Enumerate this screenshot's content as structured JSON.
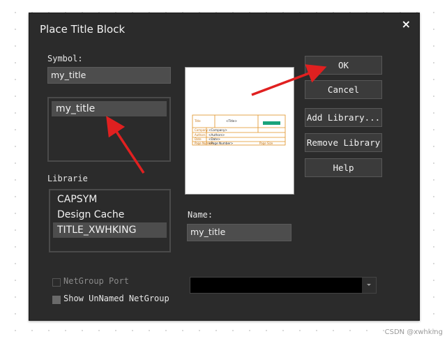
{
  "dialog": {
    "title": "Place Title Block",
    "close_glyph": "×"
  },
  "symbol": {
    "label": "Symbol:",
    "value": "my_title",
    "list": [
      {
        "label": "my_title",
        "selected": true
      }
    ]
  },
  "libraries": {
    "label": "Librarie",
    "items": [
      {
        "label": "CAPSYM",
        "selected": false
      },
      {
        "label": "Design Cache",
        "selected": false
      },
      {
        "label": "TITLE_XWHKING",
        "selected": true
      }
    ]
  },
  "preview": {
    "title_label": "Title",
    "title_value": "<Title>",
    "logo_text": "",
    "row_labels": [
      "Company",
      "Authors",
      "Date",
      "Page Number"
    ],
    "row_values": [
      "<Company>",
      "<Authors>",
      "<Date>",
      "<Page Number>"
    ],
    "size_label": "Page Size"
  },
  "buttons": {
    "ok": "OK",
    "cancel": "Cancel",
    "add_library": "Add Library...",
    "remove_library": "Remove Library",
    "help": "Help"
  },
  "name": {
    "label": "Name:",
    "value": "my_title"
  },
  "options": {
    "netgroup_port": {
      "label": "NetGroup Port",
      "checked": false,
      "disabled": true
    },
    "show_unnamed_netgroup": {
      "label": "Show UnNamed NetGroup",
      "checked": false
    }
  },
  "dropdown": {
    "value": ""
  },
  "watermark": "CSDN @xwhking",
  "colors": {
    "dialog_bg": "#2b2b2b",
    "field_bg": "#4d4d4d",
    "arrow": "#e02020",
    "title_block_border": "#e09020",
    "title_block_logo": "#1aa37a"
  }
}
